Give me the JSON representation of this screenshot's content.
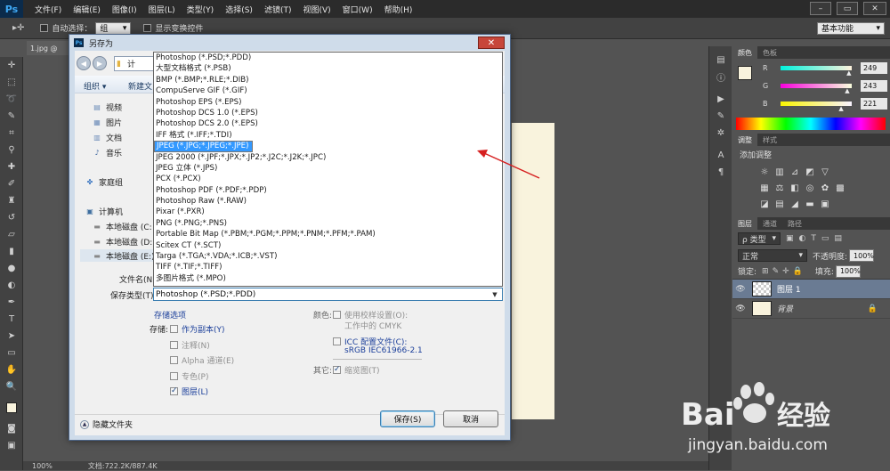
{
  "menubar": {
    "logo": "Ps",
    "items": [
      "文件(F)",
      "编辑(E)",
      "图像(I)",
      "图层(L)",
      "类型(Y)",
      "选择(S)",
      "滤镜(T)",
      "视图(V)",
      "窗口(W)",
      "帮助(H)"
    ]
  },
  "options": {
    "auto_select_label": "自动选择：",
    "auto_select_value": "组",
    "show_transform_label": "显示变换控件",
    "workspace": "基本功能"
  },
  "document": {
    "tab": "1.jpg @",
    "zoom": "100%",
    "docsize": "文档:722.2K/887.4K"
  },
  "dialog": {
    "title": "另存为",
    "close": "✕",
    "organize": "组织 ▾",
    "new_folder": "新建文",
    "path_short": "计",
    "nav": {
      "videos": "视频",
      "pictures": "图片",
      "documents": "文档",
      "music": "音乐",
      "homegroup": "家庭组",
      "computer": "计算机",
      "disk_c": "本地磁盘 (C:",
      "disk_d": "本地磁盘 (D:",
      "disk_e": "本地磁盘 (E:)"
    },
    "filename_label": "文件名(N):",
    "format_label": "保存类型(T):",
    "format_value": "Photoshop (*.PSD;*.PDD)",
    "file_types": [
      "Photoshop (*.PSD;*.PDD)",
      "大型文档格式 (*.PSB)",
      "BMP (*.BMP;*.RLE;*.DIB)",
      "CompuServe GIF (*.GIF)",
      "Photoshop EPS (*.EPS)",
      "Photoshop DCS 1.0 (*.EPS)",
      "Photoshop DCS 2.0 (*.EPS)",
      "IFF 格式 (*.IFF;*.TDI)",
      "JPEG (*.JPG;*.JPEG;*.JPE)",
      "JPEG 2000 (*.JPF;*.JPX;*.JP2;*.J2C;*.J2K;*.JPC)",
      "JPEG 立体 (*.JPS)",
      "PCX (*.PCX)",
      "Photoshop PDF (*.PDF;*.PDP)",
      "Photoshop Raw (*.RAW)",
      "Pixar (*.PXR)",
      "PNG (*.PNG;*.PNS)",
      "Portable Bit Map (*.PBM;*.PGM;*.PPM;*.PNM;*.PFM;*.PAM)",
      "Scitex CT (*.SCT)",
      "Targa (*.TGA;*.VDA;*.ICB;*.VST)",
      "TIFF (*.TIF;*.TIFF)",
      "多图片格式 (*.MPO)"
    ],
    "selected_index": 8,
    "save_options_title": "存储选项",
    "storage_label": "存储:",
    "as_copy": "作为副本(Y)",
    "annotations": "注释(N)",
    "alpha": "Alpha 通道(E)",
    "spot": "专色(P)",
    "layers": "图层(L)",
    "color_label": "颜色:",
    "use_proof": "使用校样设置(O):",
    "proof_line2": "工作中的 CMYK",
    "icc": "ICC 配置文件(C):",
    "icc_value": "sRGB IEC61966-2.1",
    "other_label": "其它:",
    "thumbnail": "缩览图(T)",
    "hide_folders": "隐藏文件夹",
    "save_btn": "保存(S)",
    "cancel_btn": "取消"
  },
  "color_panel": {
    "tabs": [
      "颜色",
      "色板"
    ],
    "r_label": "R",
    "r": "249",
    "g_label": "G",
    "g": "243",
    "b_label": "B",
    "b": "221",
    "r_fraction": 0.976,
    "g_fraction": 0.953,
    "b_fraction": 0.867,
    "swatch": "#f9f3dd"
  },
  "adjust_panel": {
    "tabs": [
      "调整",
      "样式"
    ],
    "title": "添加调整"
  },
  "layers_panel": {
    "tabs": [
      "图层",
      "通道",
      "路径"
    ],
    "filter": "ρ 类型",
    "blend": "正常",
    "opacity_label": "不透明度:",
    "opacity": "100%",
    "lock_label": "锁定:",
    "fill_label": "填充:",
    "fill": "100%",
    "layers": [
      "图层 1",
      "背景"
    ]
  },
  "watermark": {
    "text1": "Bai",
    "text2": "经验",
    "url": "jingyan.baidu.com"
  }
}
